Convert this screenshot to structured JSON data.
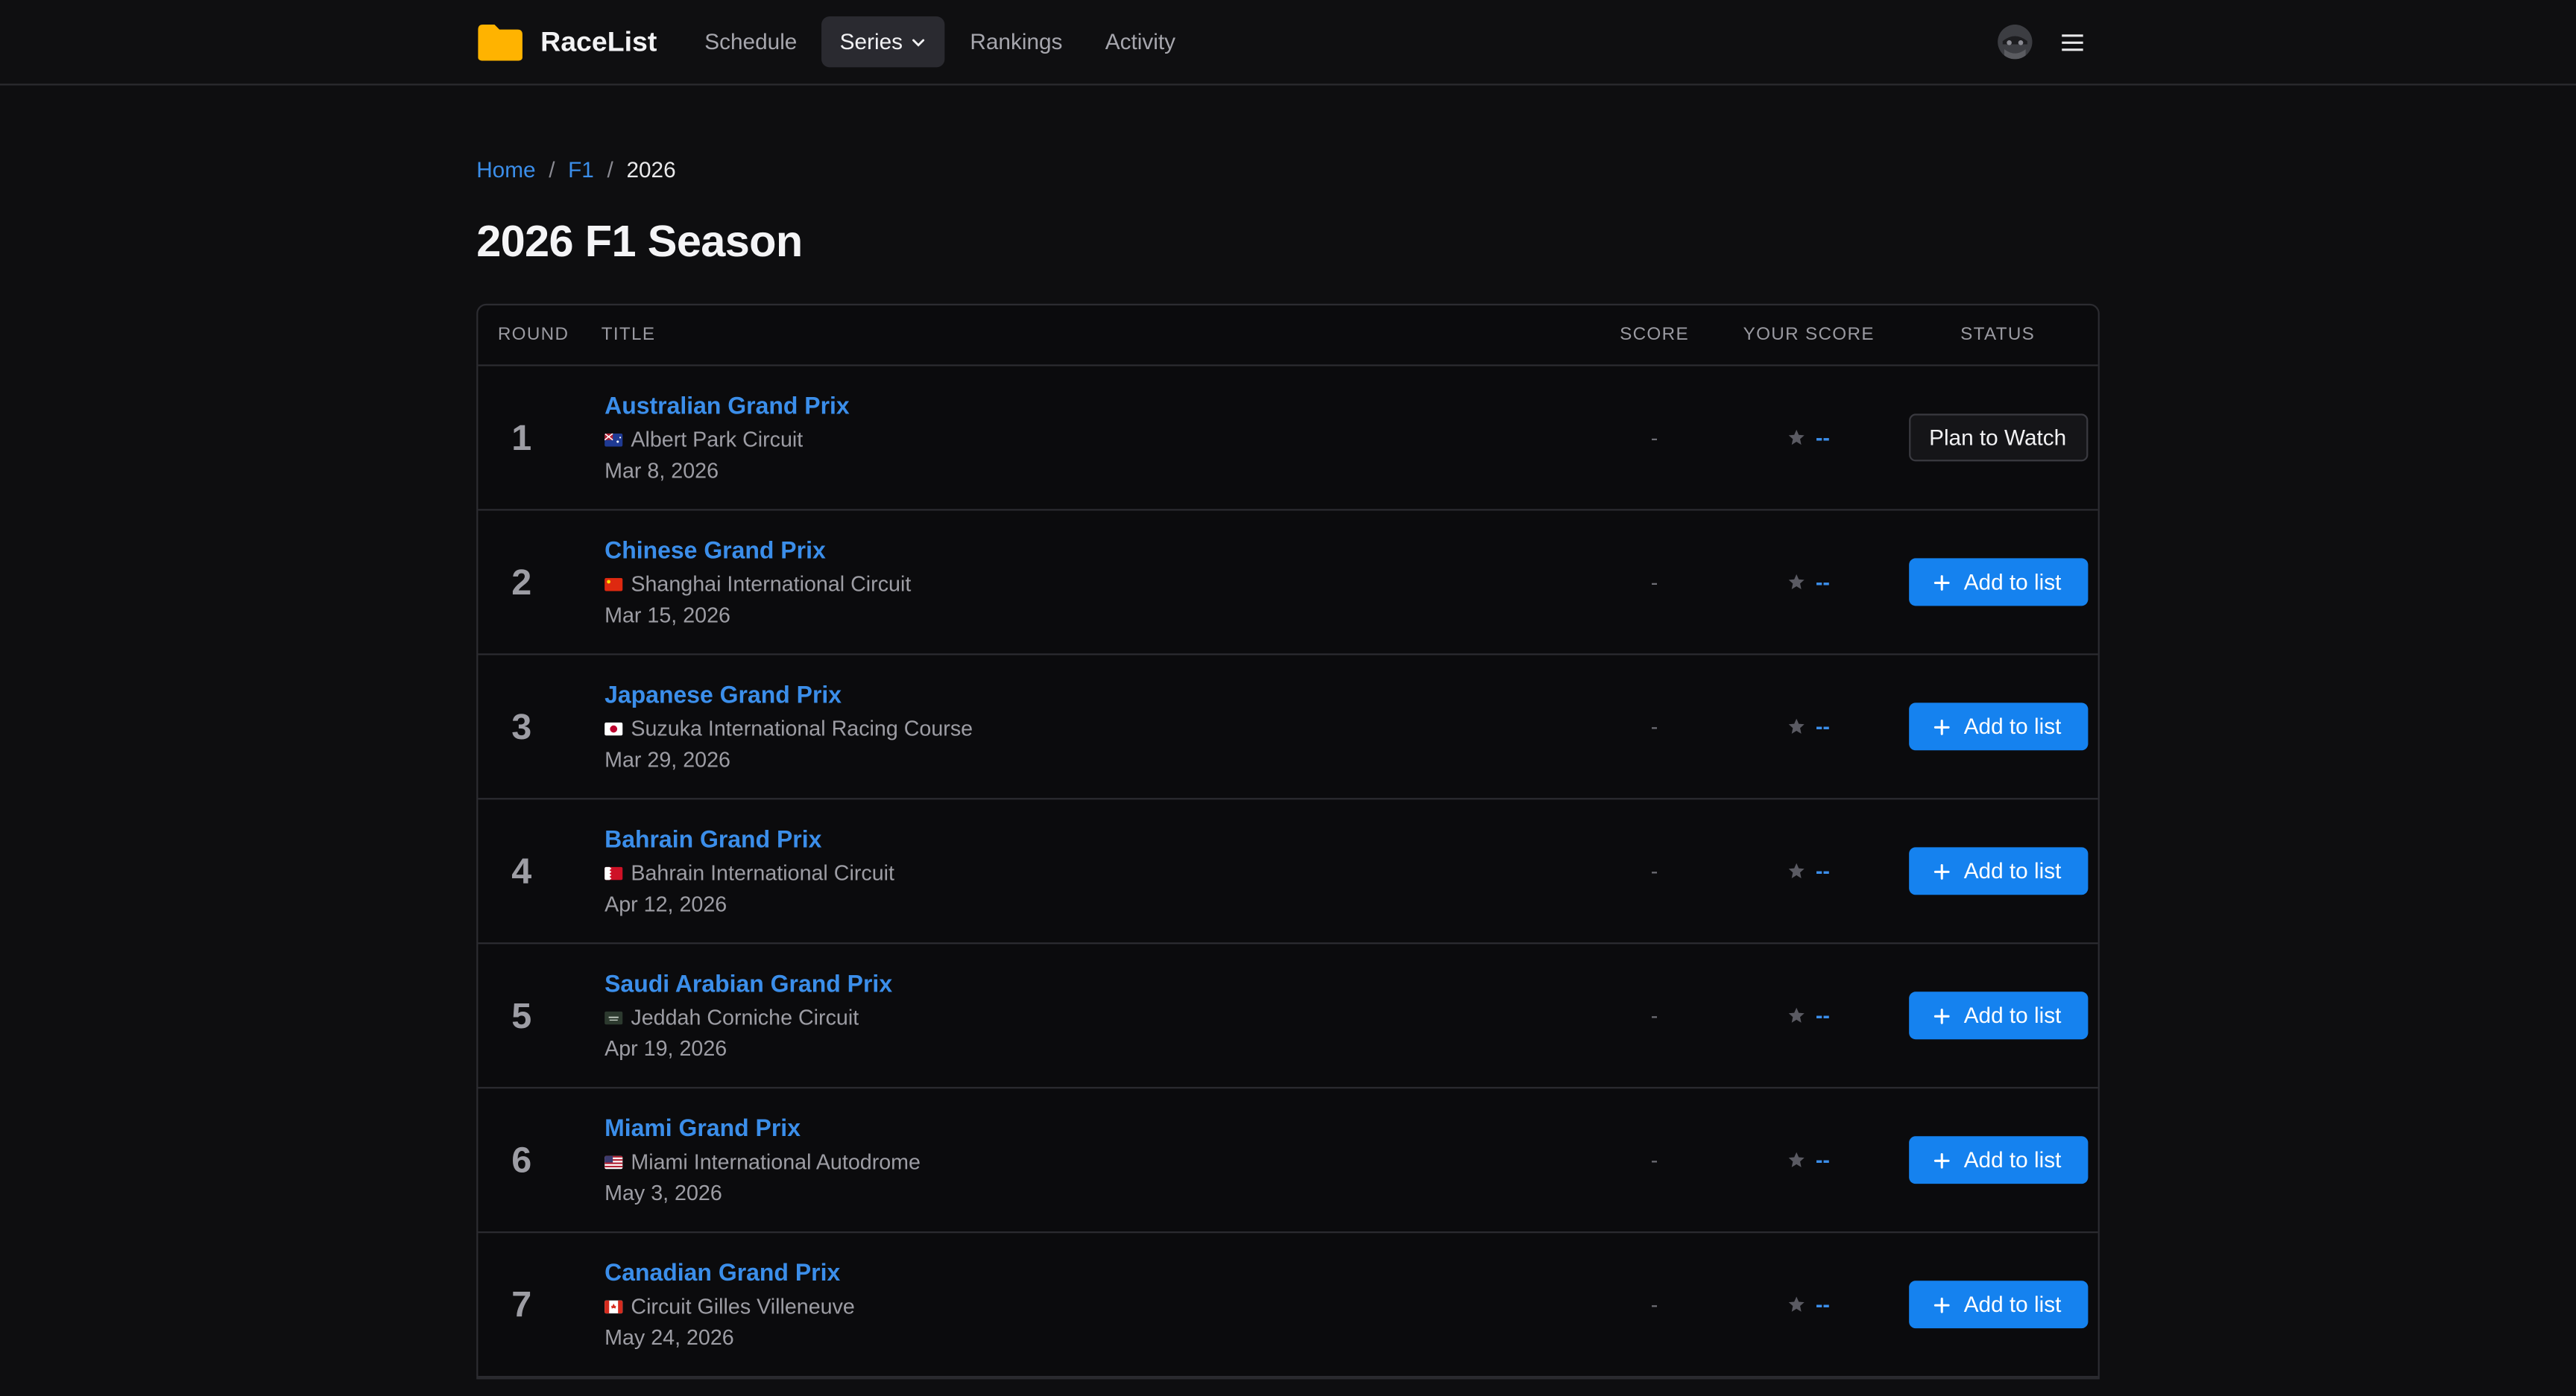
{
  "app": {
    "name": "RaceList",
    "brand_color": "#FFB300"
  },
  "nav": {
    "items": [
      {
        "label": "Schedule",
        "active": false
      },
      {
        "label": "Series",
        "active": true,
        "dropdown": true
      },
      {
        "label": "Rankings",
        "active": false
      },
      {
        "label": "Activity",
        "active": false
      }
    ]
  },
  "breadcrumb": {
    "home": "Home",
    "sep1": "/",
    "series": "F1",
    "sep2": "/",
    "current": "2026"
  },
  "page": {
    "title": "2026 F1 Season"
  },
  "table": {
    "headers": {
      "round": "ROUND",
      "title": "TITLE",
      "score": "SCORE",
      "your_score": "YOUR SCORE",
      "status": "STATUS"
    },
    "rows": [
      {
        "round": "1",
        "name": "Australian Grand Prix",
        "flag": "australia-flag-icon",
        "circuit": "Albert Park Circuit",
        "date": "Mar 8, 2026",
        "score": "-",
        "your_score": "--",
        "status": "Plan to Watch",
        "status_type": "plan"
      },
      {
        "round": "2",
        "name": "Chinese Grand Prix",
        "flag": "china-flag-icon",
        "circuit": "Shanghai International Circuit",
        "date": "Mar 15, 2026",
        "score": "-",
        "your_score": "--",
        "status": "Add to list",
        "status_type": "add"
      },
      {
        "round": "3",
        "name": "Japanese Grand Prix",
        "flag": "japan-flag-icon",
        "circuit": "Suzuka International Racing Course",
        "date": "Mar 29, 2026",
        "score": "-",
        "your_score": "--",
        "status": "Add to list",
        "status_type": "add"
      },
      {
        "round": "4",
        "name": "Bahrain Grand Prix",
        "flag": "bahrain-flag-icon",
        "circuit": "Bahrain International Circuit",
        "date": "Apr 12, 2026",
        "score": "-",
        "your_score": "--",
        "status": "Add to list",
        "status_type": "add"
      },
      {
        "round": "5",
        "name": "Saudi Arabian Grand Prix",
        "flag": "saudi-arabia-flag-icon",
        "circuit": "Jeddah Corniche Circuit",
        "date": "Apr 19, 2026",
        "score": "-",
        "your_score": "--",
        "status": "Add to list",
        "status_type": "add"
      },
      {
        "round": "6",
        "name": "Miami Grand Prix",
        "flag": "usa-flag-icon",
        "circuit": "Miami International Autodrome",
        "date": "May 3, 2026",
        "score": "-",
        "your_score": "--",
        "status": "Add to list",
        "status_type": "add"
      },
      {
        "round": "7",
        "name": "Canadian Grand Prix",
        "flag": "canada-flag-icon",
        "circuit": "Circuit Gilles Villeneuve",
        "date": "May 24, 2026",
        "score": "-",
        "your_score": "--",
        "status": "Add to list",
        "status_type": "add"
      }
    ]
  },
  "colors": {
    "accent": "#1582EF",
    "link": "#3B8EEA",
    "background": "#0E0E10"
  }
}
